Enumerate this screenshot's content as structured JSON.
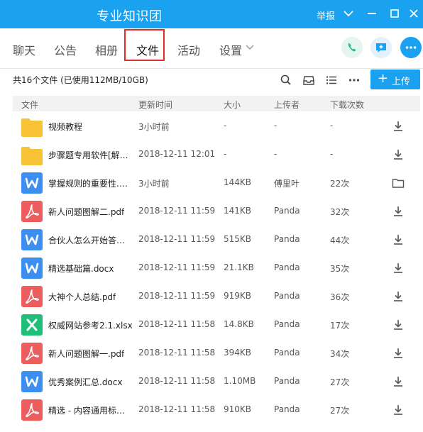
{
  "window": {
    "title": "专业知识团",
    "report_label": "举报"
  },
  "tabs": [
    {
      "label": "聊天"
    },
    {
      "label": "公告"
    },
    {
      "label": "相册"
    },
    {
      "label": "文件"
    },
    {
      "label": "活动"
    },
    {
      "label": "设置"
    }
  ],
  "active_tab": "文件",
  "toolbar": {
    "summary": "共16个文件 (已使用112MB/10GB)",
    "upload_label": "上传"
  },
  "table": {
    "columns": [
      "文件",
      "更新时间",
      "大小",
      "上传者",
      "下载次数"
    ],
    "rows": [
      {
        "type": "folder",
        "name": "视频教程",
        "time": "3小时前",
        "size": "-",
        "uploader": "-",
        "downloads": "-",
        "action": "download-icon"
      },
      {
        "type": "folder",
        "name": "步骤题专用软件[解…",
        "time": "2018-12-11 12:01",
        "size": "-",
        "uploader": "-",
        "downloads": "-",
        "action": "download-icon"
      },
      {
        "type": "word",
        "name": "掌握规则的重要性.…",
        "time": "3小时前",
        "size": "144KB",
        "uploader": "傅里叶",
        "downloads": "22次",
        "action": "folder-open-icon"
      },
      {
        "type": "pdf",
        "name": "新人问题图解二.pdf",
        "time": "2018-12-11 11:59",
        "size": "141KB",
        "uploader": "Panda",
        "downloads": "32次",
        "action": "download-icon"
      },
      {
        "type": "word",
        "name": "合伙人怎么开始答…",
        "time": "2018-12-11 11:59",
        "size": "515KB",
        "uploader": "Panda",
        "downloads": "44次",
        "action": "download-icon"
      },
      {
        "type": "word",
        "name": "精选基础篇.docx",
        "time": "2018-12-11 11:59",
        "size": "21.1KB",
        "uploader": "Panda",
        "downloads": "35次",
        "action": "download-icon"
      },
      {
        "type": "pdf",
        "name": "大神个人总结.pdf",
        "time": "2018-12-11 11:59",
        "size": "919KB",
        "uploader": "Panda",
        "downloads": "36次",
        "action": "download-icon"
      },
      {
        "type": "excel",
        "name": "权威网站参考2.1.xlsx",
        "time": "2018-12-11 11:58",
        "size": "14.8KB",
        "uploader": "Panda",
        "downloads": "17次",
        "action": "download-icon"
      },
      {
        "type": "pdf",
        "name": "新人问题图解一.pdf",
        "time": "2018-12-11 11:58",
        "size": "394KB",
        "uploader": "Panda",
        "downloads": "34次",
        "action": "download-icon"
      },
      {
        "type": "word",
        "name": "优秀案例汇总.docx",
        "time": "2018-12-11 11:58",
        "size": "1.10MB",
        "uploader": "Panda",
        "downloads": "27次",
        "action": "download-icon"
      },
      {
        "type": "pdf",
        "name": "精选 - 内容通用标…",
        "time": "2018-12-11 11:58",
        "size": "910KB",
        "uploader": "Panda",
        "downloads": "27次",
        "action": "download-icon"
      }
    ]
  },
  "colors": {
    "accent": "#1aa1ef",
    "folder": "#f8c236",
    "word": "#3c8ff0",
    "pdf": "#ee5d5d",
    "excel": "#1dbf79",
    "highlight": "#e0302a"
  }
}
